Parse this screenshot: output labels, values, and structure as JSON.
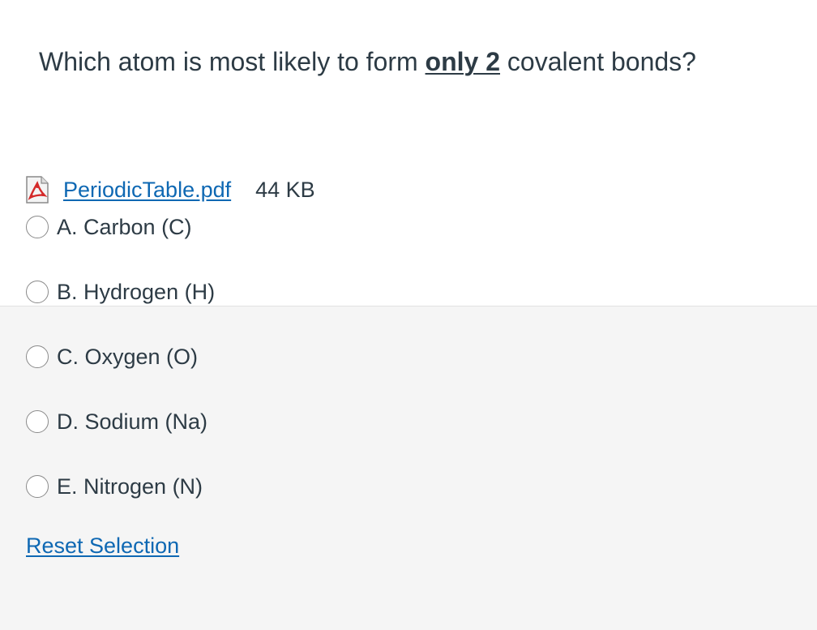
{
  "question": {
    "prefix": "Which atom is most likely to form ",
    "emphasis": "only 2",
    "suffix": " covalent bonds?"
  },
  "attachment": {
    "icon": "pdf-file-icon",
    "filename": "PeriodicTable.pdf",
    "size": "44 KB"
  },
  "answers": [
    {
      "label": "A. Carbon (C)",
      "selected": false
    },
    {
      "label": "B. Hydrogen (H)",
      "selected": false
    },
    {
      "label": "C. Oxygen (O)",
      "selected": false
    },
    {
      "label": "D. Sodium (Na)",
      "selected": false
    },
    {
      "label": "E. Nitrogen (N)",
      "selected": false
    }
  ],
  "reset_label": "Reset Selection",
  "colors": {
    "text": "#2d3b45",
    "link": "#0e68b3",
    "panel_background": "#f5f5f5"
  }
}
